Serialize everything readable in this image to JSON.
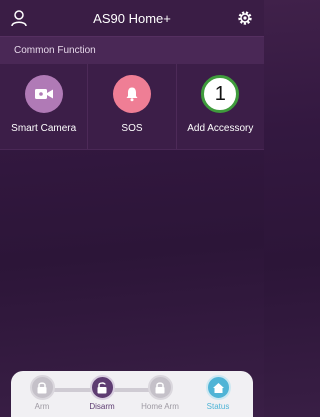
{
  "header": {
    "title": "AS90 Home+",
    "left_icon": "user-icon",
    "right_icon": "gear-icon"
  },
  "section": {
    "title": "Common Function"
  },
  "functions": [
    {
      "label": "Smart Camera",
      "icon": "camera-icon",
      "color": "#b07ab6"
    },
    {
      "label": "SOS",
      "icon": "bell-icon",
      "color": "#ef7e95"
    },
    {
      "label": "Add Accessory",
      "badge": "1",
      "color": "#3f9b3c"
    }
  ],
  "bottom_bar": {
    "items": [
      {
        "label": "Arm",
        "icon": "lock-closed-icon"
      },
      {
        "label": "Disarm",
        "icon": "lock-open-icon",
        "selected": true
      },
      {
        "label": "Home Arm",
        "icon": "home-lock-icon"
      },
      {
        "label": "Status",
        "icon": "home-icon"
      }
    ],
    "colors": {
      "selected": "#5e3c72",
      "status": "#50b4d6",
      "inactive": "#c5c1c9"
    }
  }
}
